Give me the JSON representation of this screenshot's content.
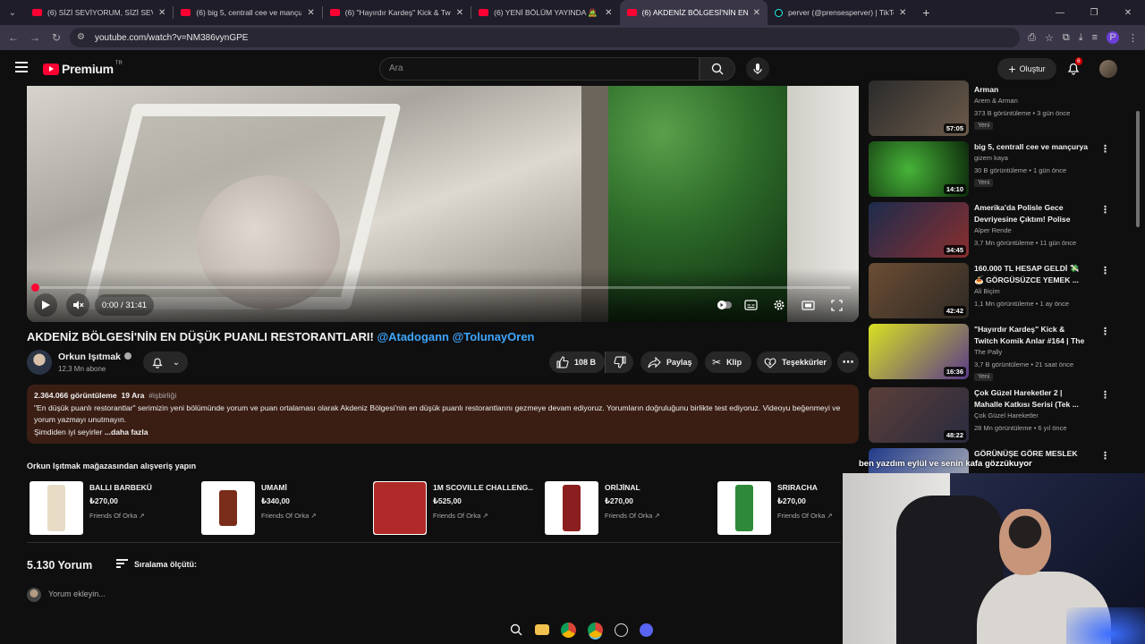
{
  "browser": {
    "tabs": [
      {
        "title": "(6) SİZİ SEVİYORUM, SİZİ SEVİY",
        "type": "youtube"
      },
      {
        "title": "(6) big 5, centrall cee ve mançu",
        "type": "youtube"
      },
      {
        "title": "(6) \"Hayırdır Kardeş\" Kick & Tw",
        "type": "youtube"
      },
      {
        "title": "(6) YENİ BÖLÜM YAYINDA 🧟 ",
        "type": "youtube"
      },
      {
        "title": "(6) AKDENİZ BÖLGESİ'NİN EN D",
        "type": "youtube",
        "active": true
      },
      {
        "title": "perver (@prensesperver) | TikTo",
        "type": "tiktok"
      }
    ],
    "url": "youtube.com/watch?v=NM386vynGPE",
    "profile_initial": "P"
  },
  "masthead": {
    "logo_word": "Premium",
    "region": "TR",
    "search_placeholder": "Ara",
    "create_label": "Oluştur",
    "notif_count": "6"
  },
  "player": {
    "time": "0:00 / 31:41",
    "progress_fraction": 0.0
  },
  "video": {
    "title": "AKDENİZ BÖLGESİ'NİN EN DÜŞÜK PUANLI RESTORANTLARI!",
    "mentions": "@Atadogann @TolunayOren",
    "channel": "Orkun Işıtmak",
    "subs": "12,3 Mn abone",
    "likes": "108 B",
    "share": "Paylaş",
    "clip": "Klip",
    "thanks": "Teşekkürler"
  },
  "description": {
    "views": "2.364.066 görüntüleme",
    "date": "19 Ara",
    "tag": "#işbirliği",
    "line1": "\"En düşük puanlı restorantlar\" serimizin yeni bölümünde yorum ve puan ortalaması olarak Akdeniz Bölgesi'nin en düşük puanlı restorantlarını gezmeye devam ediyoruz. Yorumların doğruluğunu birlikte test ediyoruz. Videoyu beğenmeyi ve yorum yazmayı unutmayın.",
    "line3": "Şimdiden iyi seyirler",
    "more": "...daha fazla"
  },
  "store": {
    "title": "Orkun Işıtmak mağazasından alışveriş yapın",
    "products": [
      {
        "name": "BALLI BARBEKÜ",
        "price": "₺270,00",
        "seller": "Friends Of Orka"
      },
      {
        "name": "UMAMİ",
        "price": "₺340,00",
        "seller": "Friends Of Orka"
      },
      {
        "name": "1M SCOVILLE CHALLENG...",
        "price": "₺525,00",
        "seller": "Friends Of Orka"
      },
      {
        "name": "ORİJİNAL",
        "price": "₺270,00",
        "seller": "Friends Of Orka"
      },
      {
        "name": "SRIRACHA",
        "price": "₺270,00",
        "seller": "Friends Of Orka"
      }
    ]
  },
  "comments": {
    "count": "5.130 Yorum",
    "sort": "Sıralama ölçütü:",
    "placeholder": "Yorum ekleyin..."
  },
  "sidebar": [
    {
      "title": "Arman",
      "channel": "Arem & Arman",
      "stats": "373 B görüntüleme • 3 gün önce",
      "duration": "57:05",
      "badge": "Yeni"
    },
    {
      "title": "big 5, centrall cee ve mançurya",
      "channel": "gizem kaya",
      "stats": "30 B görüntüleme • 1 gün önce",
      "duration": "14:10",
      "badge": "Yeni"
    },
    {
      "title": "Amerika'da Polisle Gece Devriyesine Çıktım! Polise Küf...",
      "channel": "Alper Rende",
      "stats": "3,7 Mn görüntüleme • 11 gün önce",
      "duration": "34:45",
      "badge": ""
    },
    {
      "title": "160.000 TL HESAP GELDİ 💸 🍝 GÖRGÜSÜZCE YEMEK ...",
      "channel": "Ali Biçim",
      "stats": "1,1 Mn görüntüleme • 1 ay önce",
      "duration": "42:42",
      "badge": ""
    },
    {
      "title": "\"Hayırdır Kardeş\" Kick & Twitch Komik Anlar #164 | The Pally",
      "channel": "The Pally",
      "stats": "3,7 B görüntüleme • 21 saat önce",
      "duration": "16:36",
      "badge": "Yeni"
    },
    {
      "title": "Çok Güzel Hareketler 2 | Mahalle Katkısı Serisi (Tek ...",
      "channel": "Çok Güzel Hareketler",
      "stats": "28 Mn görüntüleme • 6 yıl önce",
      "duration": "48:22",
      "badge": ""
    },
    {
      "title": "GÖRÜNÜŞE GÖRE MESLEK",
      "channel": "",
      "stats": "",
      "duration": "",
      "badge": ""
    }
  ],
  "overlay_text": "ben yazdım eylül ve senin kafa gözzükuyor"
}
